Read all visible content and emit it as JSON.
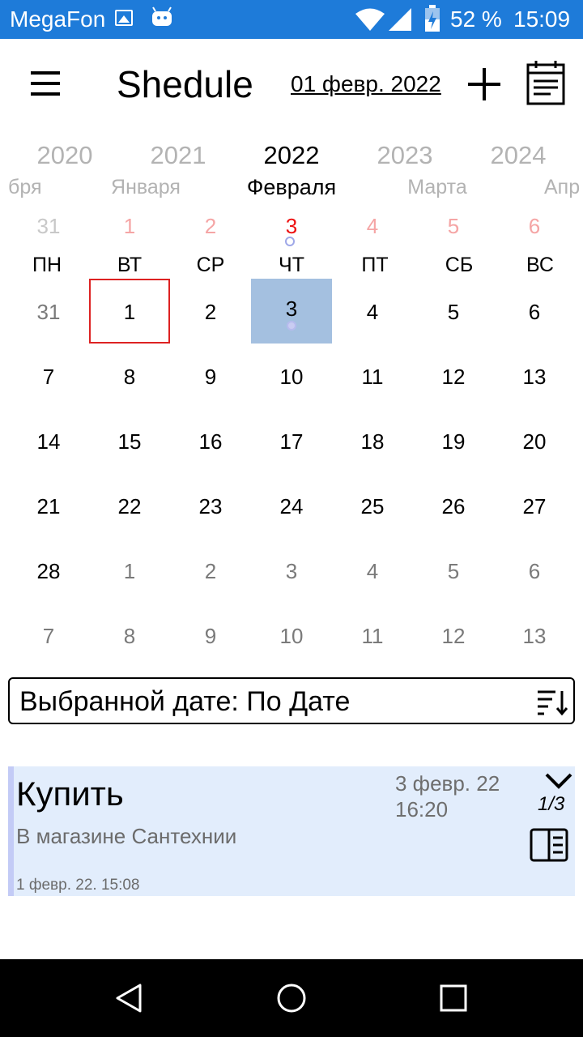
{
  "status_bar": {
    "carrier": "MegaFon",
    "battery": "52 %",
    "time": "15:09",
    "icons": [
      "image-icon",
      "android-icon",
      "wifi-icon",
      "signal-icon",
      "battery-charging-icon"
    ]
  },
  "app_bar": {
    "title": "Shedule",
    "current_date": "01 февр. 2022",
    "icons": [
      "menu-icon",
      "add-icon",
      "calendar-icon"
    ]
  },
  "years": [
    "2020",
    "2021",
    "2022",
    "2023",
    "2024"
  ],
  "months": [
    "бря",
    "Января",
    "Февраля",
    "Марта",
    "Апр"
  ],
  "week_strip": [
    "31",
    "1",
    "2",
    "3",
    "4",
    "5",
    "6"
  ],
  "weekdays": [
    "ПН",
    "ВТ",
    "СР",
    "ЧТ",
    "ПТ",
    "СБ",
    "ВС"
  ],
  "calendar": {
    "rows": [
      [
        "31",
        "1",
        "2",
        "3",
        "4",
        "5",
        "6"
      ],
      [
        "7",
        "8",
        "9",
        "10",
        "11",
        "12",
        "13"
      ],
      [
        "14",
        "15",
        "16",
        "17",
        "18",
        "19",
        "20"
      ],
      [
        "21",
        "22",
        "23",
        "24",
        "25",
        "26",
        "27"
      ],
      [
        "28",
        "1",
        "2",
        "3",
        "4",
        "5",
        "6"
      ],
      [
        "7",
        "8",
        "9",
        "10",
        "11",
        "12",
        "13"
      ]
    ],
    "today_label": "1",
    "selected_label": "3"
  },
  "filter": {
    "label": "Выбранной дате: По Дате"
  },
  "event": {
    "title": "Купить",
    "date": "3 февр. 22",
    "time": "16:20",
    "description": "В магазине Сантехнии",
    "created": "1 февр. 22. 15:08",
    "counter": "1/3"
  },
  "colors": {
    "status_bar": "#1e7bd9",
    "selected_day": "#a4c0e0",
    "today_border": "#dd2222",
    "card_background": "#e2edfc",
    "card_accent": "#c3cbf6"
  }
}
